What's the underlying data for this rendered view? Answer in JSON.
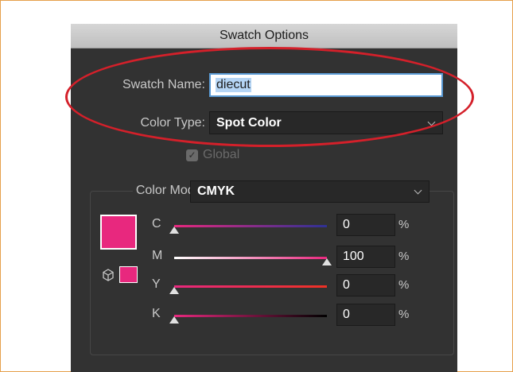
{
  "dialog": {
    "title": "Swatch Options",
    "swatch_name": {
      "label": "Swatch Name:",
      "value": "diecut"
    },
    "color_type": {
      "label": "Color Type:",
      "value": "Spot Color"
    },
    "global": {
      "label": "Global",
      "checked": true
    },
    "color_mode": {
      "label": "Color Mode:",
      "value": "CMYK"
    },
    "swatch_color": "#e8287e",
    "channels": [
      {
        "letter": "C",
        "value": "0",
        "unit": "%",
        "level": 0,
        "gradient": [
          "#e8287e",
          "#2e3194"
        ]
      },
      {
        "letter": "M",
        "value": "100",
        "unit": "%",
        "level": 1,
        "gradient": [
          "#ffffff",
          "#e8287e"
        ]
      },
      {
        "letter": "Y",
        "value": "0",
        "unit": "%",
        "level": 0,
        "gradient": [
          "#e8287e",
          "#ee3124"
        ]
      },
      {
        "letter": "K",
        "value": "0",
        "unit": "%",
        "level": 0,
        "gradient": [
          "#e8287e",
          "#000000"
        ]
      }
    ]
  },
  "highlight_color": "#d4202a"
}
